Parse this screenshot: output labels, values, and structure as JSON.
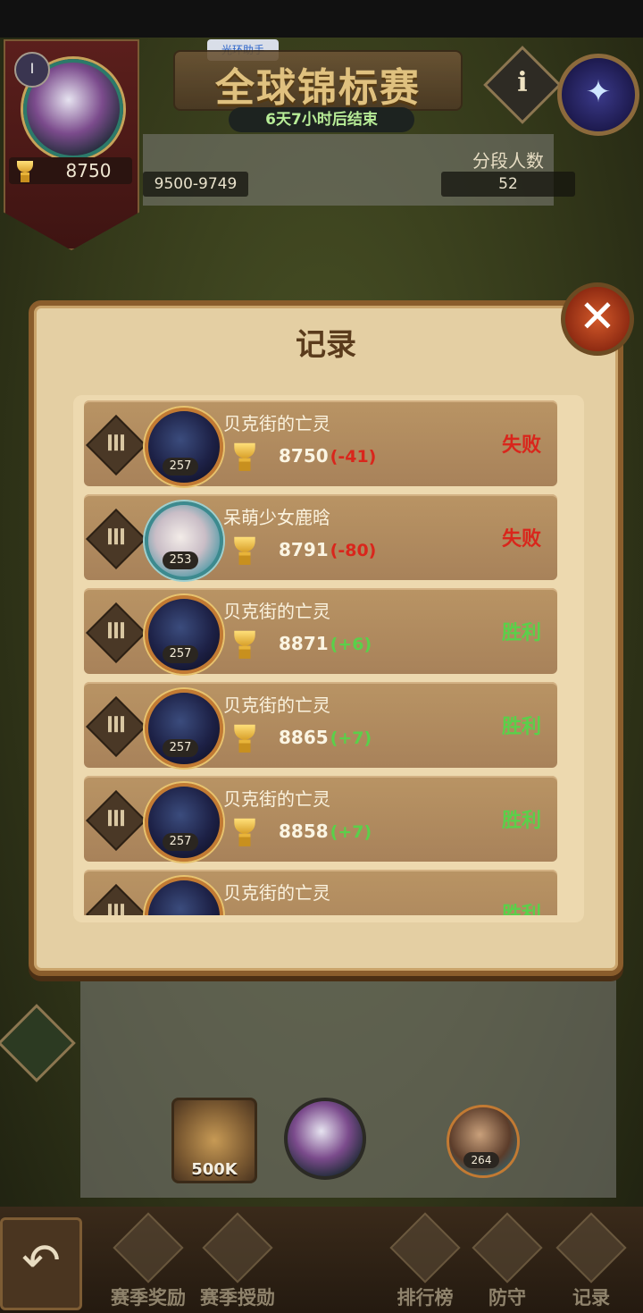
{
  "status_bar": {
    "helper_label": "光环助手"
  },
  "player": {
    "score": "8750",
    "rank_roman": "I"
  },
  "header": {
    "title": "全球锦标赛",
    "timer": "6天7小时后结束",
    "info_label": "i",
    "range": "9500-9749",
    "segment_label": "分段人数",
    "segment_count": "52"
  },
  "dialog": {
    "title": "记录",
    "close_label": "✕",
    "records": [
      {
        "name": "贝克街的亡灵",
        "level": "257",
        "score": "8750",
        "delta": "(-41)",
        "result": "失败",
        "outcome": "lose",
        "avatar": "hero"
      },
      {
        "name": "呆萌少女鹿晗",
        "level": "253",
        "score": "8791",
        "delta": "(-80)",
        "result": "失败",
        "outcome": "lose",
        "avatar": "girl"
      },
      {
        "name": "贝克街的亡灵",
        "level": "257",
        "score": "8871",
        "delta": "(+6)",
        "result": "胜利",
        "outcome": "win",
        "avatar": "hero"
      },
      {
        "name": "贝克街的亡灵",
        "level": "257",
        "score": "8865",
        "delta": "(+7)",
        "result": "胜利",
        "outcome": "win",
        "avatar": "hero"
      },
      {
        "name": "贝克街的亡灵",
        "level": "257",
        "score": "8858",
        "delta": "(+7)",
        "result": "胜利",
        "outcome": "win",
        "avatar": "hero"
      },
      {
        "name": "贝克街的亡灵",
        "level": "",
        "score": "",
        "delta": "",
        "result": "胜利",
        "outcome": "win",
        "avatar": "hero"
      }
    ]
  },
  "map": {
    "chest_label": "500K",
    "enemy_level": "264"
  },
  "bottom_nav": {
    "back_label": "↶",
    "items": [
      {
        "label": "赛季奖励",
        "icon": "crown-chest-icon"
      },
      {
        "label": "赛季授勋",
        "icon": "medal-icon"
      },
      {
        "label": "排行榜",
        "icon": "scroll-icon"
      },
      {
        "label": "防守",
        "icon": "shield-icon"
      },
      {
        "label": "记录",
        "icon": "record-scroll-icon"
      }
    ]
  },
  "colors": {
    "lose": "#d9261c",
    "win": "#5ad04a",
    "panel": "#e4cfa3"
  }
}
